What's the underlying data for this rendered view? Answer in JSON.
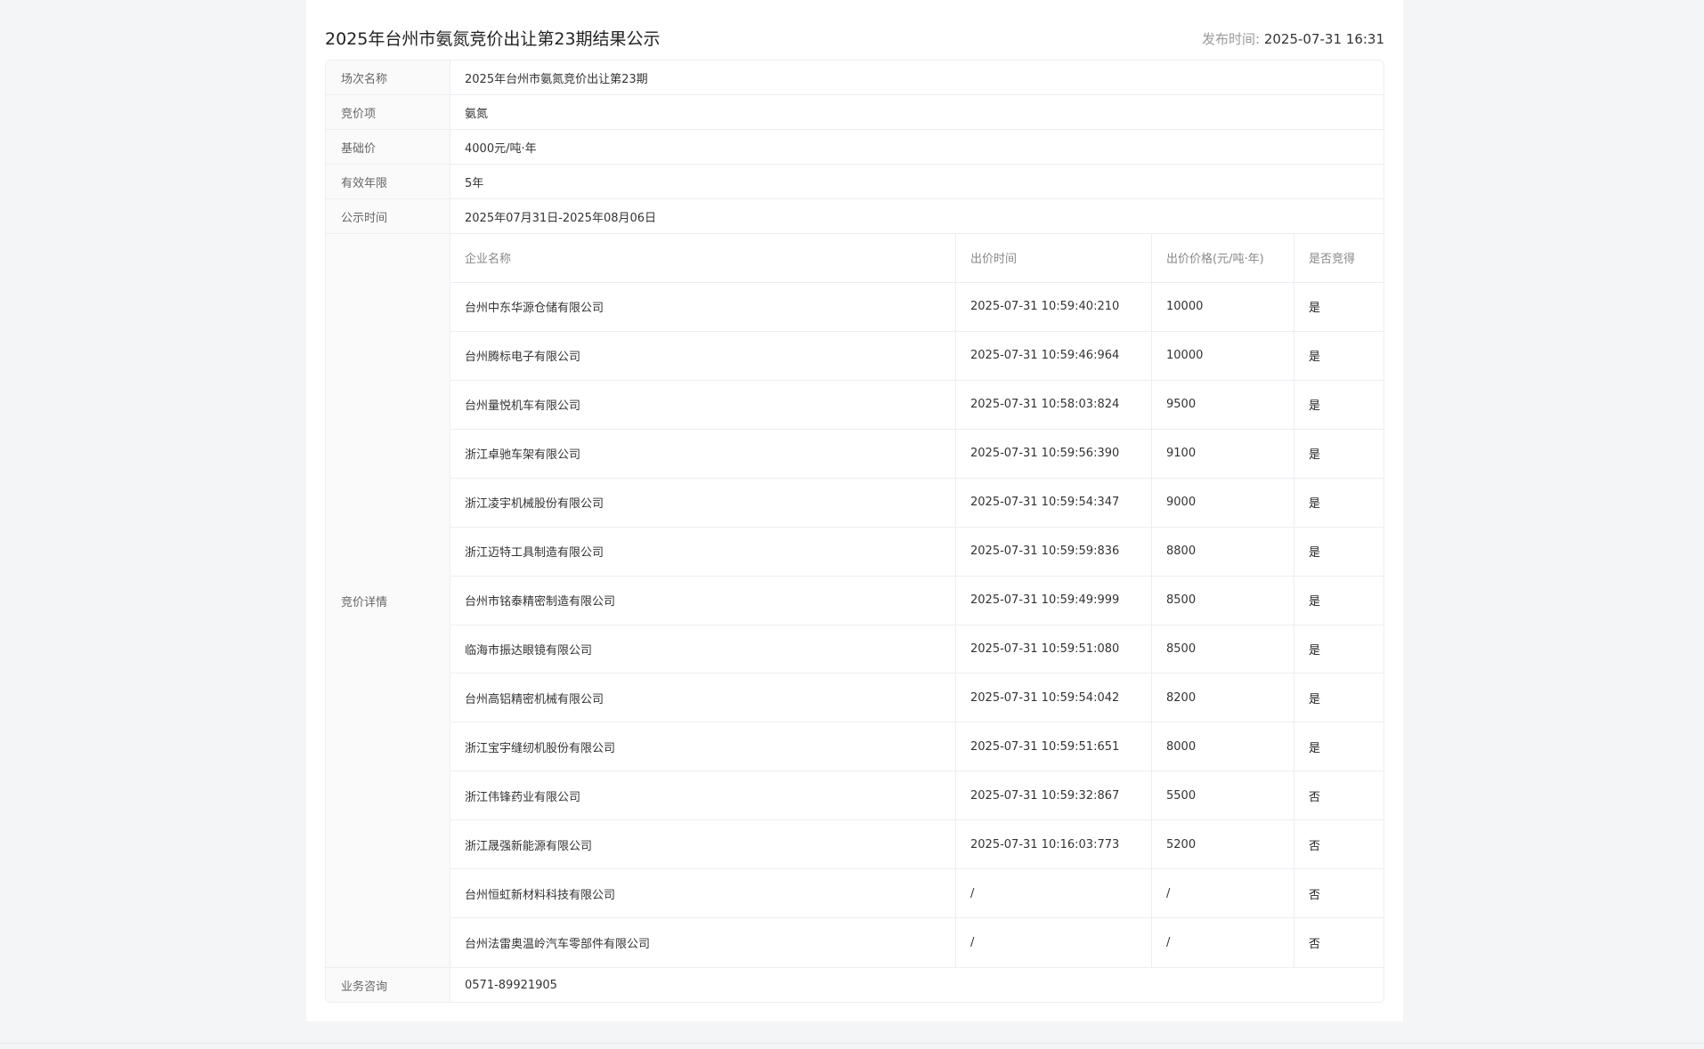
{
  "title": "2025年台州市氨氮竞价出让第23期结果公示",
  "publish": {
    "label": "发布时间: ",
    "value": "2025-07-31 16:31"
  },
  "info": {
    "session_label": "场次名称",
    "session_value": "2025年台州市氨氮竞价出让第23期",
    "item_label": "竞价项",
    "item_value": "氨氮",
    "base_price_label": "基础价",
    "base_price_value": "4000元/吨·年",
    "validity_label": "有效年限",
    "validity_value": "5年",
    "notice_label": "公示时间",
    "notice_value": "2025年07月31日-2025年08月06日",
    "detail_label": "竞价详情",
    "consult_label": "业务咨询",
    "consult_value": "0571-89921905"
  },
  "bids": {
    "headers": [
      "企业名称",
      "出价时间",
      "出价价格(元/吨·年)",
      "是否竞得"
    ],
    "rows": [
      [
        "台州中东华源仓储有限公司",
        "2025-07-31 10:59:40:210",
        "10000",
        "是"
      ],
      [
        "台州腾标电子有限公司",
        "2025-07-31 10:59:46:964",
        "10000",
        "是"
      ],
      [
        "台州量悦机车有限公司",
        "2025-07-31 10:58:03:824",
        "9500",
        "是"
      ],
      [
        "浙江卓驰车架有限公司",
        "2025-07-31 10:59:56:390",
        "9100",
        "是"
      ],
      [
        "浙江凌宇机械股份有限公司",
        "2025-07-31 10:59:54:347",
        "9000",
        "是"
      ],
      [
        "浙江迈特工具制造有限公司",
        "2025-07-31 10:59:59:836",
        "8800",
        "是"
      ],
      [
        "台州市铭泰精密制造有限公司",
        "2025-07-31 10:59:49:999",
        "8500",
        "是"
      ],
      [
        "临海市振达眼镜有限公司",
        "2025-07-31 10:59:51:080",
        "8500",
        "是"
      ],
      [
        "台州高铝精密机械有限公司",
        "2025-07-31 10:59:54:042",
        "8200",
        "是"
      ],
      [
        "浙江宝宇缝纫机股份有限公司",
        "2025-07-31 10:59:51:651",
        "8000",
        "是"
      ],
      [
        "浙江伟锋药业有限公司",
        "2025-07-31 10:59:32:867",
        "5500",
        "否"
      ],
      [
        "浙江晟强新能源有限公司",
        "2025-07-31 10:16:03:773",
        "5200",
        "否"
      ],
      [
        "台州恒虹新材料科技有限公司",
        "/",
        "/",
        "否"
      ],
      [
        "台州法雷奥温岭汽车零部件有限公司",
        "/",
        "/",
        "否"
      ]
    ]
  }
}
